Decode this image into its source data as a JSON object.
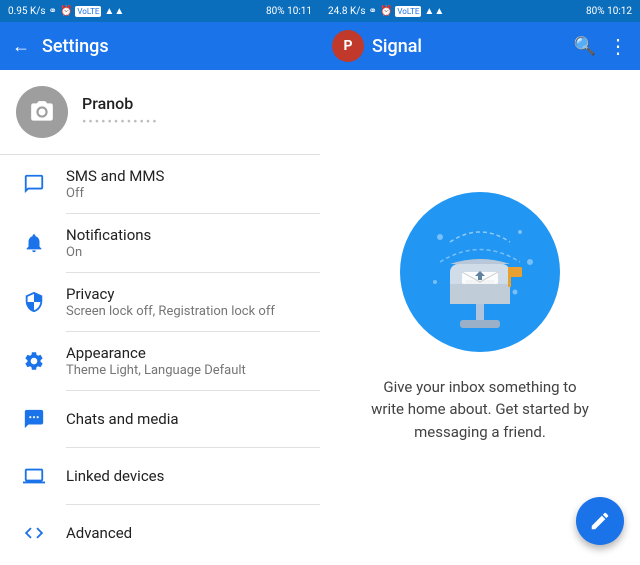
{
  "left": {
    "status_bar": {
      "left": "0.95 K/s",
      "right": "80%  10:11"
    },
    "top_bar": {
      "back_icon": "←",
      "title": "Settings"
    },
    "profile": {
      "name": "Pranob",
      "subtitle": "••••••••••••"
    },
    "settings_items": [
      {
        "id": "sms",
        "label": "SMS and MMS",
        "sublabel": "Off",
        "icon": "chat"
      },
      {
        "id": "notifications",
        "label": "Notifications",
        "sublabel": "On",
        "icon": "bell"
      },
      {
        "id": "privacy",
        "label": "Privacy",
        "sublabel": "Screen lock off, Registration lock off",
        "icon": "shield"
      },
      {
        "id": "appearance",
        "label": "Appearance",
        "sublabel": "Theme Light, Language Default",
        "icon": "settings"
      },
      {
        "id": "chats",
        "label": "Chats and media",
        "sublabel": "",
        "icon": "bubble"
      },
      {
        "id": "linked",
        "label": "Linked devices",
        "sublabel": "",
        "icon": "laptop"
      },
      {
        "id": "advanced",
        "label": "Advanced",
        "sublabel": "",
        "icon": "code"
      }
    ]
  },
  "right": {
    "status_bar": {
      "left": "24.8 K/s",
      "right": "80%  10:12"
    },
    "top_bar": {
      "avatar_letter": "P",
      "title": "Signal"
    },
    "empty_state": {
      "text": "Give your inbox something to write home about. Get started by messaging a friend."
    },
    "fab_icon": "pencil"
  }
}
